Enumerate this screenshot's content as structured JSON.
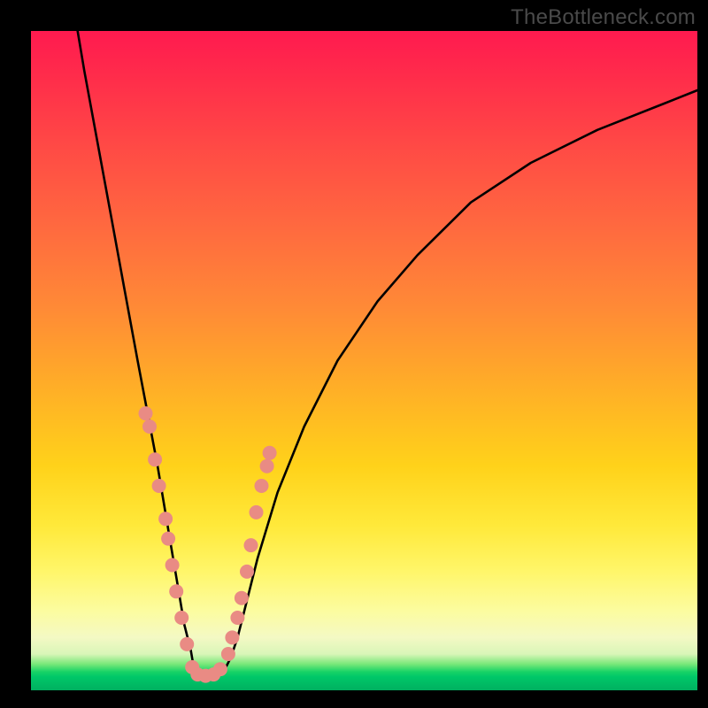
{
  "watermark": "TheBottleneck.com",
  "chart_data": {
    "type": "line",
    "title": "",
    "xlabel": "",
    "ylabel": "",
    "xlim": [
      0,
      100
    ],
    "ylim": [
      0,
      100
    ],
    "grid": false,
    "legend": false,
    "series": [
      {
        "name": "curve",
        "color": "#000000",
        "x": [
          7,
          8,
          10,
          12,
          14,
          16,
          17.5,
          19,
          20,
          21,
          22,
          23,
          24,
          24.5,
          25,
          27,
          29,
          30,
          31,
          32,
          34,
          37,
          41,
          46,
          52,
          58,
          66,
          75,
          85,
          95,
          100
        ],
        "y": [
          100,
          94,
          83,
          72,
          61,
          50,
          42,
          34,
          28,
          22,
          16,
          10,
          6,
          3,
          2,
          2,
          3,
          5,
          8,
          12,
          20,
          30,
          40,
          50,
          59,
          66,
          74,
          80,
          85,
          89,
          91
        ]
      }
    ],
    "markers": [
      {
        "name": "dots",
        "color": "#e98b84",
        "radius_px": 8,
        "points": [
          [
            17.2,
            42
          ],
          [
            17.8,
            40
          ],
          [
            18.6,
            35
          ],
          [
            19.2,
            31
          ],
          [
            20.2,
            26
          ],
          [
            20.6,
            23
          ],
          [
            21.2,
            19
          ],
          [
            21.8,
            15
          ],
          [
            22.6,
            11
          ],
          [
            23.4,
            7
          ],
          [
            24.2,
            3.5
          ],
          [
            25.0,
            2.4
          ],
          [
            26.2,
            2.2
          ],
          [
            27.4,
            2.4
          ],
          [
            28.4,
            3.2
          ],
          [
            29.6,
            5.5
          ],
          [
            30.2,
            8
          ],
          [
            31.0,
            11
          ],
          [
            31.6,
            14
          ],
          [
            32.4,
            18
          ],
          [
            33.0,
            22
          ],
          [
            33.8,
            27
          ],
          [
            34.6,
            31
          ],
          [
            35.4,
            34
          ],
          [
            35.8,
            36
          ]
        ]
      }
    ],
    "background_gradient": {
      "orientation": "vertical",
      "stops": [
        {
          "pos": 0.0,
          "color": "#ff1a4f"
        },
        {
          "pos": 0.3,
          "color": "#ff6a3f"
        },
        {
          "pos": 0.66,
          "color": "#ffd21a"
        },
        {
          "pos": 0.9,
          "color": "#f4f9c4"
        },
        {
          "pos": 0.97,
          "color": "#17d366"
        },
        {
          "pos": 1.0,
          "color": "#00b060"
        }
      ]
    }
  }
}
